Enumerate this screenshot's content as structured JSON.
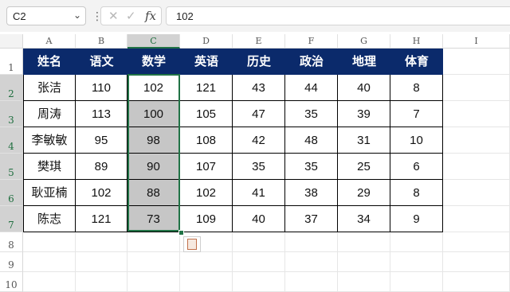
{
  "formula_bar": {
    "name_box": "C2",
    "name_box_icon": "chevron-down-icon",
    "cancel_icon": "cancel-icon",
    "enter_icon": "check-icon",
    "fx_label": "fx",
    "formula": "102"
  },
  "columns": [
    "A",
    "B",
    "C",
    "D",
    "E",
    "F",
    "G",
    "H",
    "I"
  ],
  "rows": [
    "1",
    "2",
    "3",
    "4",
    "5",
    "6",
    "7",
    "8",
    "9",
    "10"
  ],
  "table": {
    "headers": [
      "姓名",
      "语文",
      "数学",
      "英语",
      "历史",
      "政治",
      "地理",
      "体育"
    ],
    "data": [
      [
        "张洁",
        "110",
        "102",
        "121",
        "43",
        "44",
        "40",
        "8"
      ],
      [
        "周涛",
        "113",
        "100",
        "105",
        "47",
        "35",
        "39",
        "7"
      ],
      [
        "李敏敏",
        "95",
        "98",
        "108",
        "42",
        "48",
        "31",
        "10"
      ],
      [
        "樊琪",
        "89",
        "90",
        "107",
        "35",
        "35",
        "25",
        "6"
      ],
      [
        "耿亚楠",
        "102",
        "88",
        "102",
        "41",
        "38",
        "29",
        "8"
      ],
      [
        "陈志",
        "121",
        "73",
        "109",
        "40",
        "37",
        "34",
        "9"
      ]
    ]
  },
  "selection": {
    "active_cell": "C2",
    "range": "C2:C7"
  },
  "colors": {
    "header_bg": "#0b2a6b",
    "header_text": "#ffffff",
    "selection_fill": "#c6c6c6",
    "selection_border": "#217346"
  },
  "paste_options_icon": "paste-options-icon"
}
